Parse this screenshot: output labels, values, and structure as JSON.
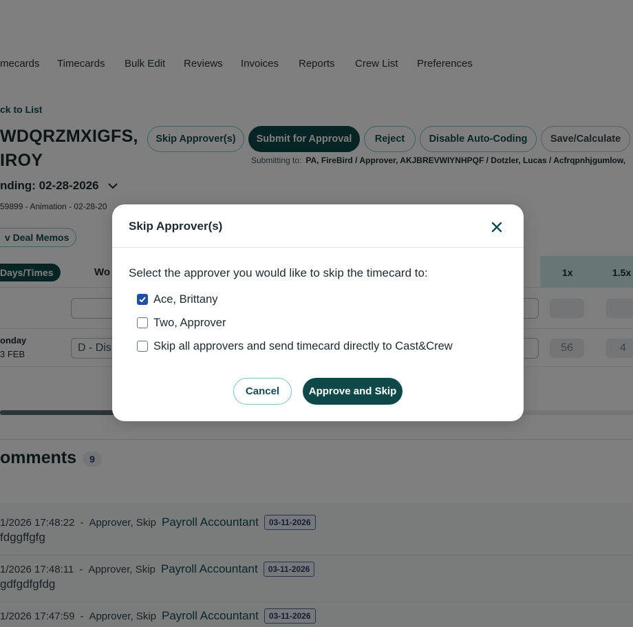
{
  "nav": {
    "items": [
      "mecards",
      "Timecards",
      "Bulk Edit",
      "Reviews",
      "Invoices",
      "Reports",
      "Crew List",
      "Preferences"
    ]
  },
  "header": {
    "back_link": "ck to List",
    "name_line1": "WDQRZMXIGFS,",
    "name_line2": "IROY",
    "week_ending": "nding: 02-28-2026",
    "deal_line": "59899 - Animation - 02-28-20",
    "submitting_label": "Submitting to:",
    "submitting_value": "PA, FireBird / Approver, AKJBREVWIYNHPQF / Dotzler, Lucas / Acfrqpnhjgumlow,"
  },
  "actions": {
    "skip_approvers": "Skip Approver(s)",
    "submit_for_approval": "Submit for Approval",
    "reject": "Reject",
    "disable_auto_coding": "Disable Auto-Coding",
    "save_calculate": "Save/Calculate"
  },
  "deal_memos_button": "v Deal Memos",
  "grid": {
    "days_times_tab": "Days/Times",
    "col_wo": "Wo",
    "rate_headers": [
      "1x",
      "1.5x"
    ],
    "row2": {
      "day": "onday",
      "date": "3 FEB",
      "input_value": "D - Dis",
      "cells": [
        "56",
        "4"
      ]
    }
  },
  "comments": {
    "title": "omments",
    "count": "9",
    "items": [
      {
        "timestamp": "1/2026 17:48:22",
        "author": "Approver, Skip",
        "role": "Payroll Accountant",
        "date": "03-11-2026",
        "text": "fdggffgfg"
      },
      {
        "timestamp": "1/2026 17:48:11",
        "author": "Approver, Skip",
        "role": "Payroll Accountant",
        "date": "03-11-2026",
        "text": "gdfgdfgfdg"
      },
      {
        "timestamp": "1/2026 17:47:59",
        "author": "Approver, Skip",
        "role": "Payroll Accountant",
        "date": "03-11-2026",
        "text": ""
      }
    ]
  },
  "modal": {
    "title": "Skip Approver(s)",
    "prompt": "Select the approver you would like to skip the timecard to:",
    "options": [
      {
        "label": "Ace, Brittany",
        "checked": true
      },
      {
        "label": "Two, Approver",
        "checked": false
      },
      {
        "label": "Skip all approvers and send timecard directly to Cast&Crew",
        "checked": false
      }
    ],
    "cancel_label": "Cancel",
    "approve_label": "Approve and Skip"
  },
  "colors": {
    "primary": "#0e4848",
    "accent_outline": "#7ec2c2",
    "checkbox": "#1e4fa0",
    "rate_header_bg": "#d2ecec"
  }
}
